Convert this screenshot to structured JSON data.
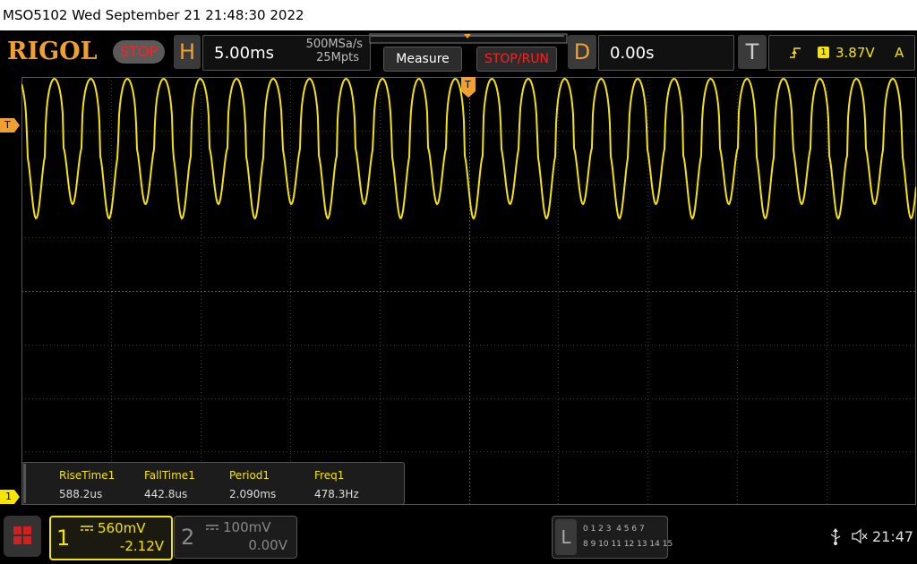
{
  "titlebar": {
    "text": "MSO5102  Wed September 21 21:48:30 2022"
  },
  "header": {
    "logo": "RIGOL",
    "run_state": "STOP",
    "horizontal": {
      "letter": "H",
      "timebase": "5.00ms",
      "sample_rate": "500MSa/s",
      "memory_depth": "25Mpts"
    },
    "measure_button": "Measure",
    "stop_run_button": "STOP/RUN",
    "delay": {
      "letter": "D",
      "value": "0.00s"
    },
    "trigger": {
      "letter": "T",
      "source": "1",
      "level": "3.87V",
      "mode": "A"
    }
  },
  "markers": {
    "trigger_level": "T",
    "trigger_position": "T",
    "ch1_ground": "1"
  },
  "measurements": {
    "headers": [
      "RiseTime1",
      "FallTime1",
      "Period1",
      "Freq1"
    ],
    "values": [
      "588.2us",
      "442.8us",
      "2.090ms",
      "478.3Hz"
    ]
  },
  "channels": {
    "ch1": {
      "number": "1",
      "scale": "560mV",
      "offset": "-2.12V"
    },
    "ch2": {
      "number": "2",
      "scale": "100mV",
      "offset": "0.00V"
    }
  },
  "logic": {
    "letter": "L",
    "row1": "0 1 2 3  4 5 6 7",
    "row2": "8 9 10 11 12 13 14 15"
  },
  "status": {
    "clock": "21:47"
  },
  "colors": {
    "accent": "#f0a030",
    "ch1": "#f5e300",
    "stop": "#ff2020"
  },
  "trace": {
    "cycles_visible": 24,
    "high_ratio": 0.0,
    "period_ms": 2.09
  }
}
